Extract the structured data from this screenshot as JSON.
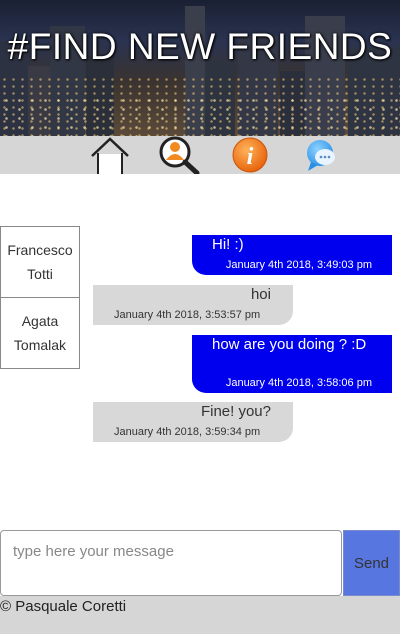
{
  "header": {
    "title": "#FIND NEW FRIENDS"
  },
  "nav": [
    {
      "icon": "home-icon"
    },
    {
      "icon": "search-people-icon"
    },
    {
      "icon": "info-icon"
    },
    {
      "icon": "chat-icon"
    }
  ],
  "friends": [
    {
      "name": "Francesco Totti"
    },
    {
      "name": "Agata Tomalak"
    }
  ],
  "messages": [
    {
      "direction": "sent",
      "text": "Hi! :)",
      "time": "January 4th 2018, 3:49:03 pm"
    },
    {
      "direction": "received",
      "text": "hoi",
      "time": "January 4th 2018, 3:53:57 pm"
    },
    {
      "direction": "sent",
      "text": "how are you doing ? :D",
      "time": "January 4th 2018, 3:58:06 pm"
    },
    {
      "direction": "received",
      "text": "Fine! you?",
      "time": "January 4th 2018, 3:59:34 pm"
    }
  ],
  "composer": {
    "placeholder": "type here your message",
    "value": "",
    "send_label": "Send"
  },
  "footer": {
    "copyright": "© Pasquale Coretti"
  },
  "colors": {
    "sent_bubble": "#0000ee",
    "received_bubble": "#d8d8d8",
    "send_button": "#5776e0",
    "nav_bar": "#d6d6d6"
  }
}
